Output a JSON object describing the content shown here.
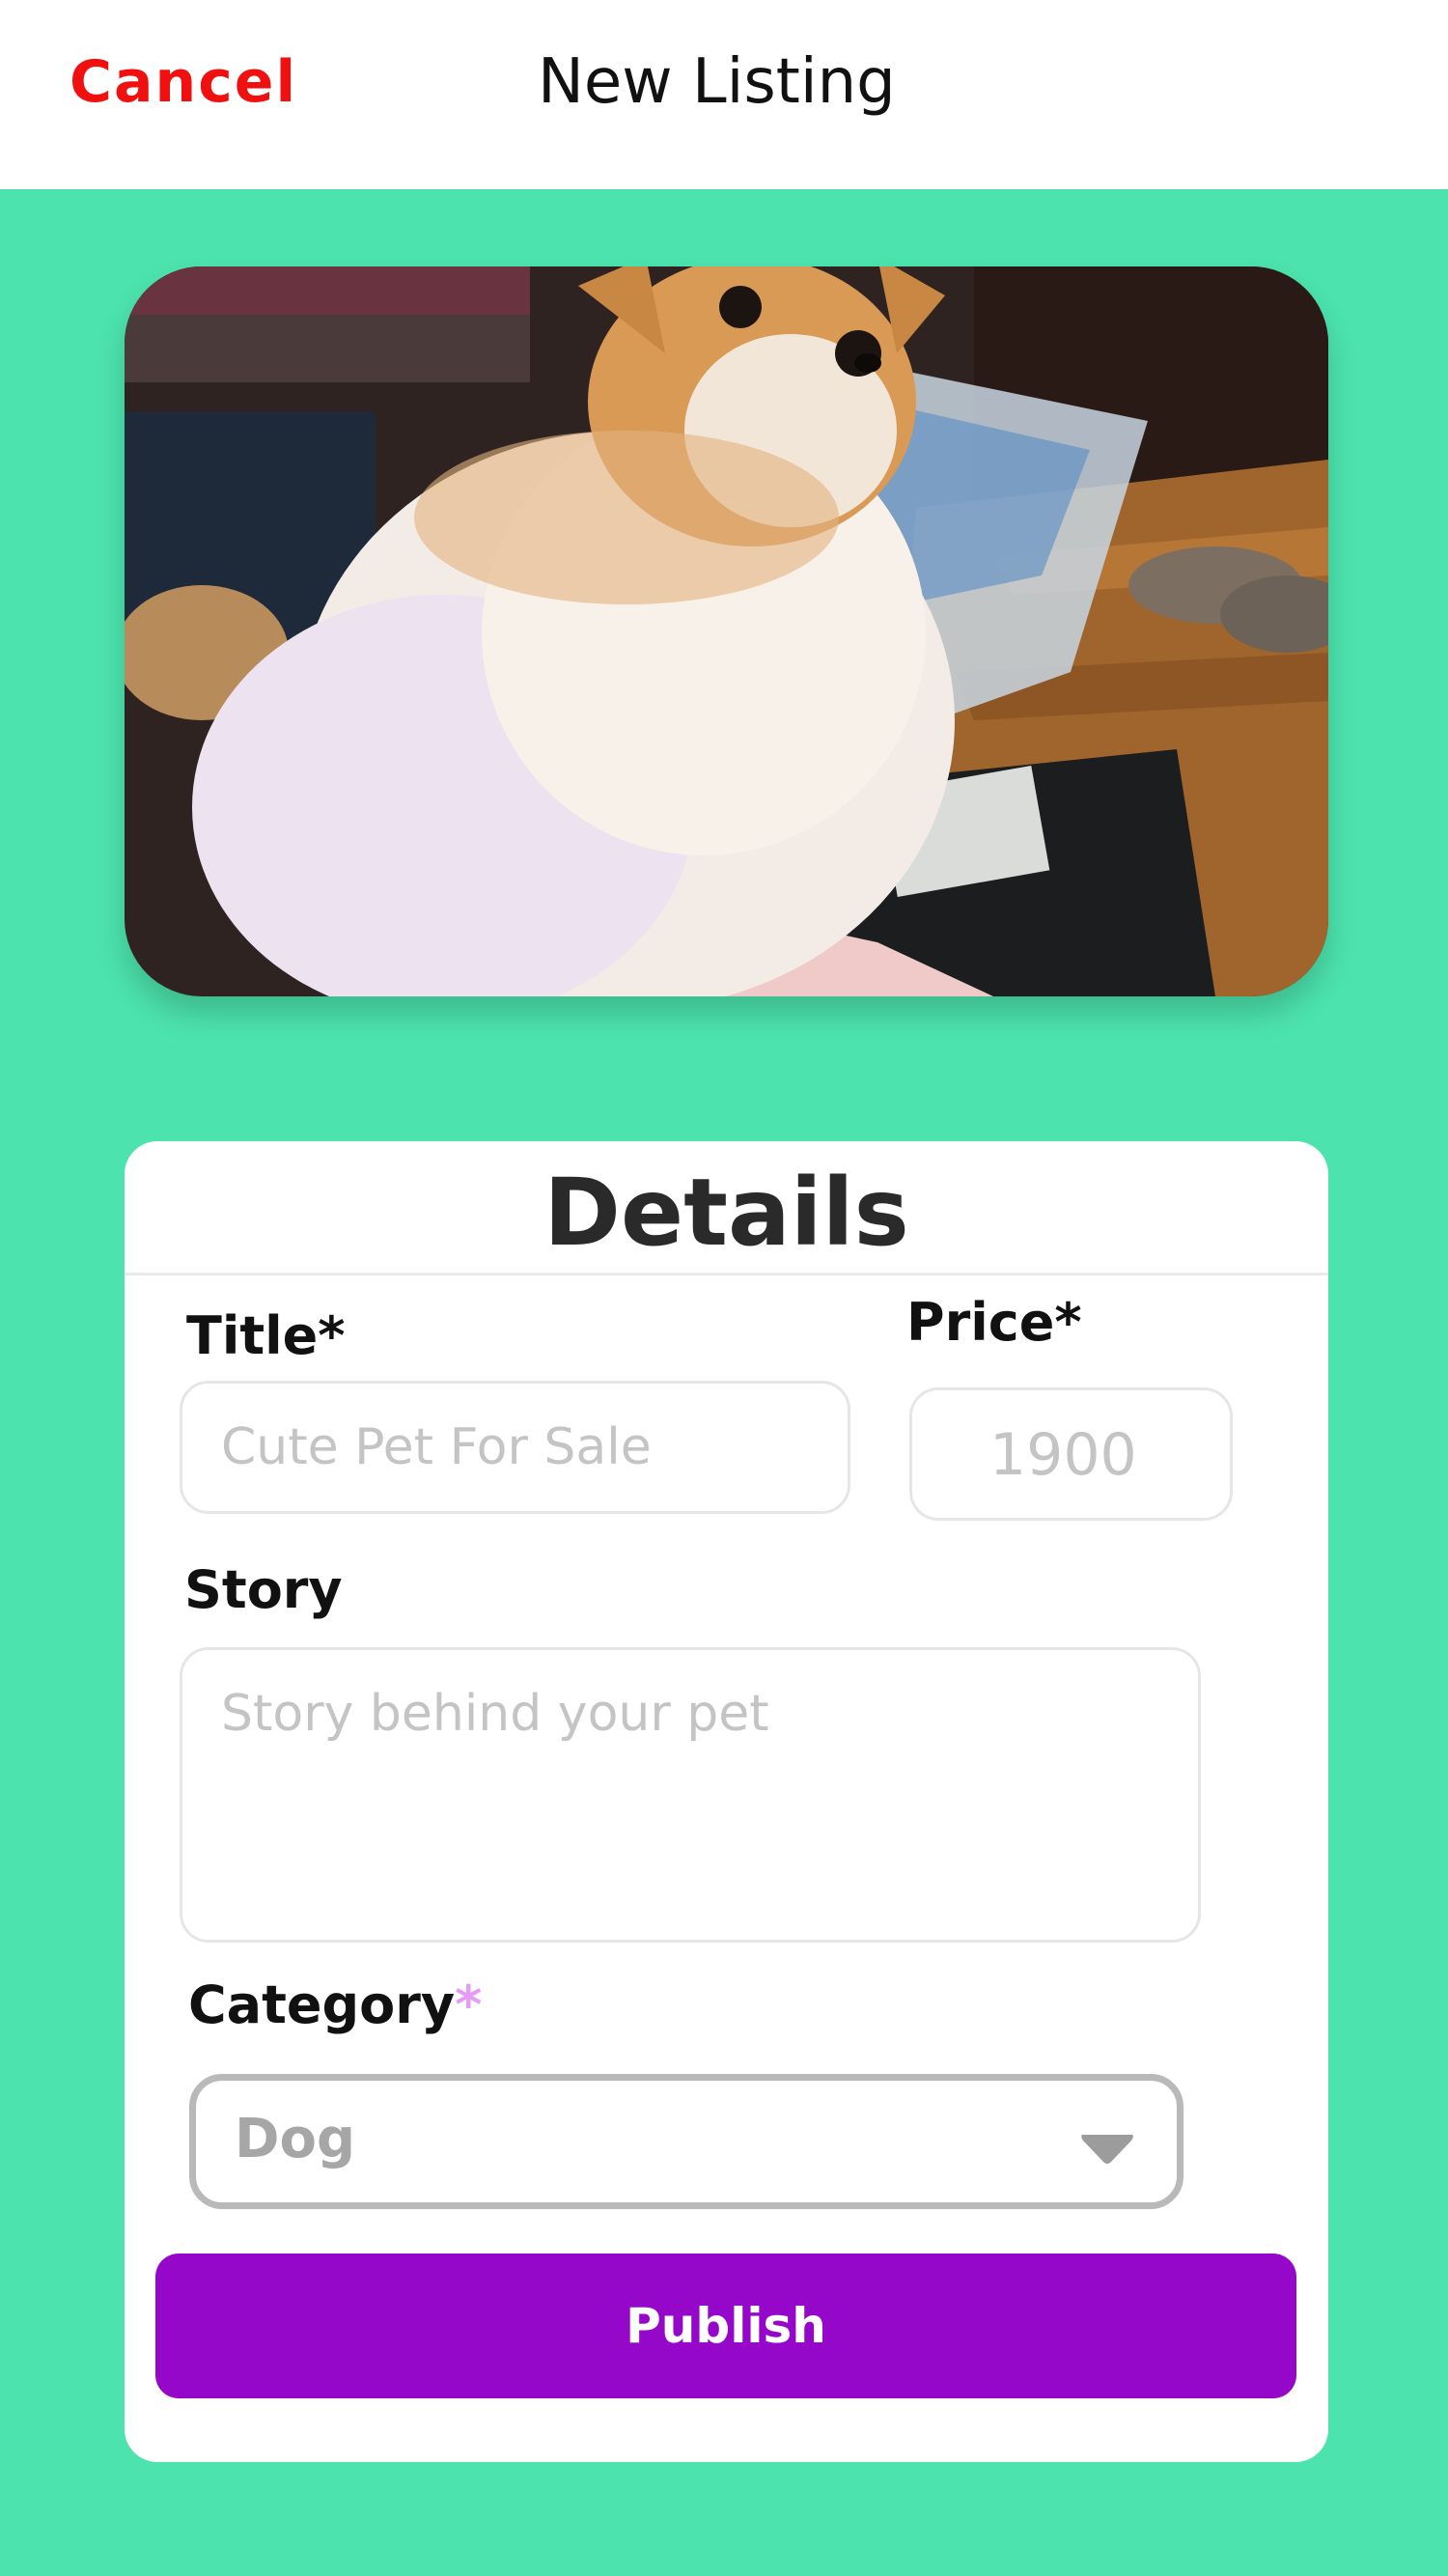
{
  "nav": {
    "cancel_label": "Cancel",
    "title": "New Listing"
  },
  "photo": {
    "subject": "pomeranian-dog-photo"
  },
  "details": {
    "heading": "Details",
    "title_label": "Title*",
    "title_placeholder": "Cute Pet For Sale",
    "price_label": "Price*",
    "price_placeholder": "1900",
    "story_label": "Story",
    "story_placeholder": "Story behind your pet",
    "category_label": "Category",
    "category_required_mark": "*",
    "category_value": "Dog",
    "publish_label": "Publish"
  },
  "colors": {
    "background": "#4ce3ae",
    "cancel": "#f01010",
    "publish": "#9508c9",
    "required_mark": "#e79bf6"
  }
}
